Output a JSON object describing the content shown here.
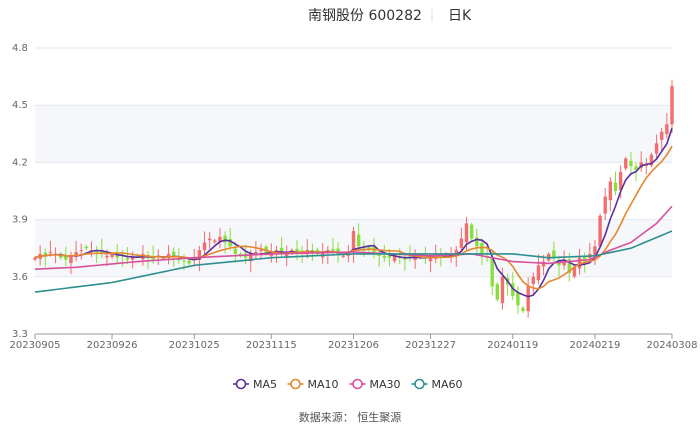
{
  "chart_data": {
    "type": "candlestick",
    "title": "南钢股份 600282",
    "period": "日K",
    "ylim": [
      3.3,
      4.8
    ],
    "yticks": [
      "3.3",
      "3.6",
      "3.9",
      "4.2",
      "4.5",
      "4.8"
    ],
    "xticks": [
      {
        "label": "20230905",
        "index": 0
      },
      {
        "label": "20230926",
        "index": 15
      },
      {
        "label": "20231025",
        "index": 31
      },
      {
        "label": "20231115",
        "index": 46
      },
      {
        "label": "20231206",
        "index": 62
      },
      {
        "label": "20231227",
        "index": 77
      },
      {
        "label": "20240119",
        "index": 93
      },
      {
        "label": "20240219",
        "index": 109
      },
      {
        "label": "20240308",
        "index": 124
      }
    ],
    "closes": [
      3.7,
      3.72,
      3.71,
      3.73,
      3.72,
      3.7,
      3.69,
      3.71,
      3.73,
      3.74,
      3.75,
      3.74,
      3.73,
      3.72,
      3.71,
      3.72,
      3.7,
      3.71,
      3.69,
      3.7,
      3.71,
      3.72,
      3.7,
      3.69,
      3.71,
      3.7,
      3.72,
      3.71,
      3.69,
      3.68,
      3.67,
      3.7,
      3.74,
      3.78,
      3.8,
      3.79,
      3.81,
      3.78,
      3.76,
      3.72,
      3.71,
      3.7,
      3.72,
      3.73,
      3.74,
      3.72,
      3.73,
      3.74,
      3.72,
      3.73,
      3.74,
      3.72,
      3.73,
      3.74,
      3.73,
      3.72,
      3.73,
      3.74,
      3.73,
      3.72,
      3.71,
      3.72,
      3.84,
      3.76,
      3.75,
      3.74,
      3.73,
      3.71,
      3.7,
      3.7,
      3.71,
      3.7,
      3.69,
      3.7,
      3.71,
      3.7,
      3.7,
      3.7,
      3.71,
      3.7,
      3.72,
      3.71,
      3.74,
      3.8,
      3.88,
      3.8,
      3.76,
      3.72,
      3.7,
      3.55,
      3.48,
      3.6,
      3.56,
      3.5,
      3.45,
      3.42,
      3.55,
      3.6,
      3.66,
      3.68,
      3.72,
      3.7,
      3.66,
      3.68,
      3.62,
      3.65,
      3.7,
      3.68,
      3.72,
      3.76,
      3.92,
      4.02,
      4.1,
      4.05,
      4.15,
      4.22,
      4.18,
      4.16,
      4.2,
      4.19,
      4.24,
      4.3,
      4.36,
      4.4,
      4.6
    ],
    "up_color": "#f26d6d",
    "down_color": "#86e03c",
    "series": [
      {
        "name": "MA5",
        "color": "#5b2e9e",
        "window": 5
      },
      {
        "name": "MA10",
        "color": "#e8862e",
        "window": 10
      },
      {
        "name": "MA30",
        "color": "#d94f9c",
        "points": [
          [
            0,
            3.64
          ],
          [
            8,
            3.65
          ],
          [
            20,
            3.68
          ],
          [
            31,
            3.7
          ],
          [
            46,
            3.72
          ],
          [
            62,
            3.73
          ],
          [
            77,
            3.71
          ],
          [
            85,
            3.72
          ],
          [
            93,
            3.68
          ],
          [
            100,
            3.67
          ],
          [
            108,
            3.69
          ],
          [
            112,
            3.74
          ],
          [
            116,
            3.78
          ],
          [
            121,
            3.88
          ],
          [
            124,
            3.97
          ]
        ]
      },
      {
        "name": "MA60",
        "color": "#2e8f8f",
        "points": [
          [
            0,
            3.52
          ],
          [
            15,
            3.57
          ],
          [
            31,
            3.66
          ],
          [
            46,
            3.7
          ],
          [
            62,
            3.72
          ],
          [
            77,
            3.72
          ],
          [
            93,
            3.72
          ],
          [
            100,
            3.7
          ],
          [
            109,
            3.71
          ],
          [
            116,
            3.75
          ],
          [
            124,
            3.84
          ]
        ]
      }
    ],
    "legend_position": "bottom",
    "grid": true
  },
  "source": "数据来源：  恒生聚源"
}
